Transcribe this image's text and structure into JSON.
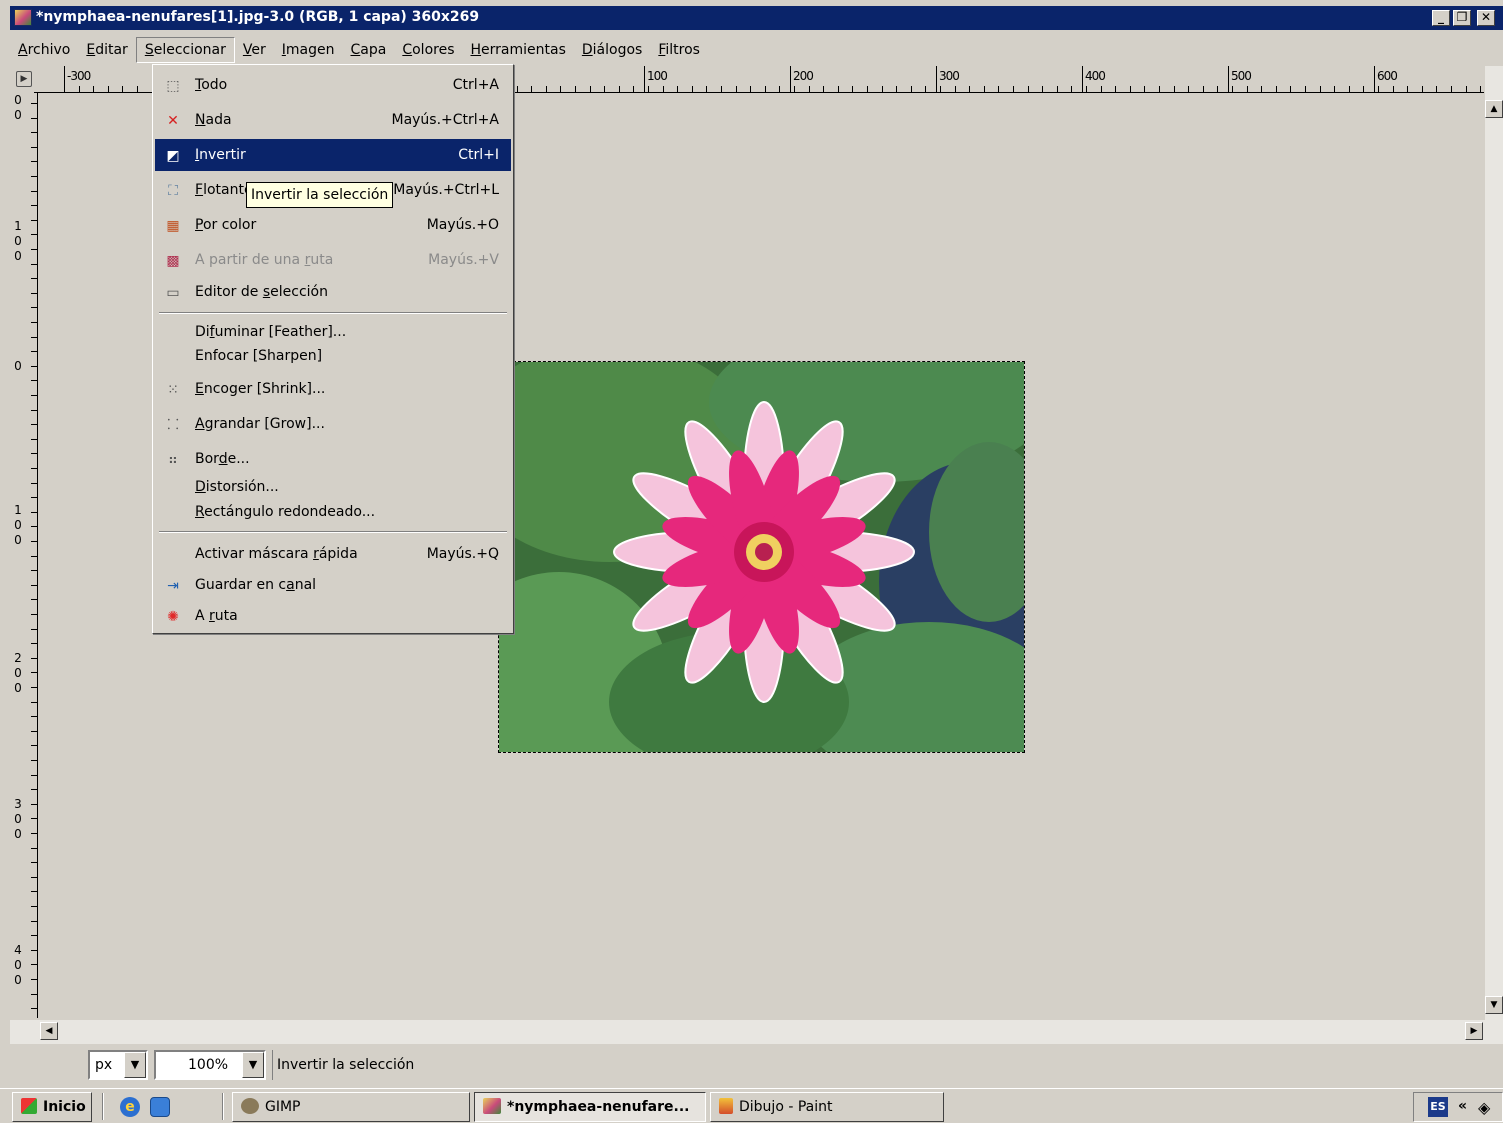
{
  "window": {
    "title": "*nymphaea-nenufares[1].jpg-3.0 (RGB, 1 capa) 360x269",
    "btn_min": "_",
    "btn_max": "❐",
    "btn_close": "✕"
  },
  "menubar": [
    {
      "pre": "",
      "ul": "A",
      "post": "rchivo"
    },
    {
      "pre": "",
      "ul": "E",
      "post": "ditar"
    },
    {
      "pre": "",
      "ul": "S",
      "post": "eleccionar"
    },
    {
      "pre": "",
      "ul": "V",
      "post": "er"
    },
    {
      "pre": "",
      "ul": "I",
      "post": "magen"
    },
    {
      "pre": "",
      "ul": "C",
      "post": "apa"
    },
    {
      "pre": "",
      "ul": "C",
      "post": "olores"
    },
    {
      "pre": "",
      "ul": "H",
      "post": "erramientas"
    },
    {
      "pre": "",
      "ul": "D",
      "post": "iálogos"
    },
    {
      "pre": "",
      "ul": "F",
      "post": "iltros"
    }
  ],
  "ruler": {
    "h_labels": [
      "-300",
      "100",
      "200",
      "300",
      "400",
      "500",
      "600"
    ],
    "v_labels": [
      [
        "0",
        "0"
      ],
      [
        "1",
        "0",
        "0"
      ],
      [
        "0"
      ],
      [
        "1",
        "0",
        "0"
      ],
      [
        "2",
        "0",
        "0"
      ],
      [
        "3",
        "0",
        "0"
      ],
      [
        "4",
        "0",
        "0"
      ]
    ]
  },
  "menu": {
    "items": [
      {
        "pre": "",
        "ul": "T",
        "post": "odo",
        "shortcut": "Ctrl+A",
        "icon": "select-all-icon"
      },
      {
        "pre": "",
        "ul": "N",
        "post": "ada",
        "shortcut": "Mayús.+Ctrl+A",
        "icon": "select-none-icon"
      },
      {
        "pre": "",
        "ul": "I",
        "post": "nvertir",
        "shortcut": "Ctrl+I",
        "icon": "invert-selection-icon"
      },
      {
        "pre": "",
        "ul": "F",
        "post": "lotante",
        "shortcut": "Mayús.+Ctrl+L",
        "icon": "float-selection-icon"
      },
      {
        "pre": "",
        "ul": "P",
        "post": "or color",
        "shortcut": "Mayús.+O",
        "icon": "select-by-color-icon"
      },
      {
        "pre": "A partir de una ",
        "ul": "r",
        "post": "uta",
        "shortcut": "Mayús.+V",
        "icon": "path-to-selection-icon"
      },
      {
        "pre": "Editor de ",
        "ul": "s",
        "post": "elección",
        "shortcut": "",
        "icon": "selection-editor-icon"
      },
      {
        "pre": "Di",
        "ul": "f",
        "post": "uminar [Feather]...",
        "shortcut": ""
      },
      {
        "pre": "Enfocar [Sharpen]",
        "ul": "",
        "post": "",
        "shortcut": ""
      },
      {
        "pre": "",
        "ul": "E",
        "post": "ncoger [Shrink]...",
        "shortcut": "",
        "icon": "shrink-selection-icon"
      },
      {
        "pre": "",
        "ul": "A",
        "post": "grandar [Grow]...",
        "shortcut": "",
        "icon": "grow-selection-icon"
      },
      {
        "pre": "Bor",
        "ul": "d",
        "post": "e...",
        "shortcut": "",
        "icon": "border-selection-icon"
      },
      {
        "pre": "",
        "ul": "D",
        "post": "istorsión...",
        "shortcut": ""
      },
      {
        "pre": "",
        "ul": "R",
        "post": "ectángulo redondeado...",
        "shortcut": ""
      },
      {
        "pre": "Activar máscara ",
        "ul": "r",
        "post": "ápida",
        "shortcut": "Mayús.+Q"
      },
      {
        "pre": "Guardar en c",
        "ul": "a",
        "post": "nal",
        "shortcut": "",
        "icon": "save-to-channel-icon"
      },
      {
        "pre": "A ",
        "ul": "r",
        "post": "uta",
        "shortcut": "",
        "icon": "to-path-icon"
      }
    ],
    "tooltip": "Invertir la selección"
  },
  "statusbar": {
    "unit": "px",
    "zoom": "100%",
    "message": "Invertir la selección"
  },
  "taskbar": {
    "start": "Inicio",
    "tasks": [
      "GIMP",
      "*nymphaea-nenufare...",
      "Dibujo - Paint"
    ],
    "lang": "ES",
    "tray_arrow": "«"
  }
}
